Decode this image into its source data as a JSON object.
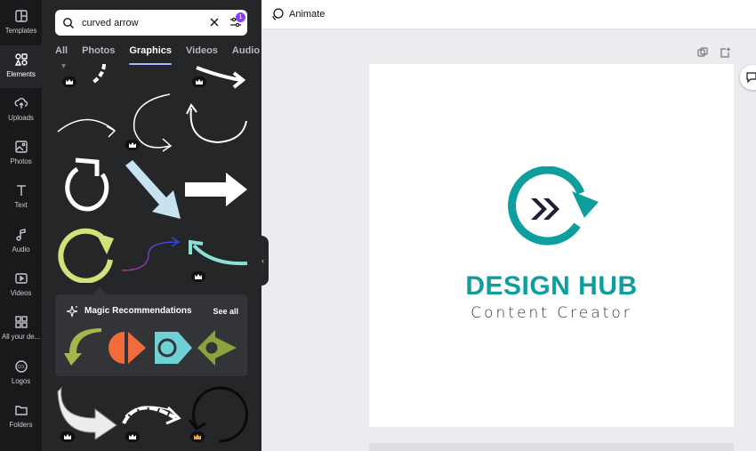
{
  "rail": {
    "items": [
      {
        "label": "Templates",
        "icon": "templates-icon"
      },
      {
        "label": "Elements",
        "icon": "elements-icon"
      },
      {
        "label": "Uploads",
        "icon": "uploads-icon"
      },
      {
        "label": "Photos",
        "icon": "photos-icon"
      },
      {
        "label": "Text",
        "icon": "text-icon"
      },
      {
        "label": "Audio",
        "icon": "audio-icon"
      },
      {
        "label": "Videos",
        "icon": "videos-icon"
      },
      {
        "label": "All your de...",
        "icon": "all-designs-icon"
      },
      {
        "label": "Logos",
        "icon": "logos-icon"
      },
      {
        "label": "Folders",
        "icon": "folders-icon"
      }
    ],
    "active": "Elements"
  },
  "search": {
    "value": "curved arrow",
    "filter_count": "1"
  },
  "tabs": [
    {
      "label": "All"
    },
    {
      "label": "Photos"
    },
    {
      "label": "Graphics"
    },
    {
      "label": "Videos"
    },
    {
      "label": "Audio"
    }
  ],
  "active_tab": "Graphics",
  "magic": {
    "title": "Magic Recommendations",
    "see_all": "See all"
  },
  "topbar": {
    "animate_label": "Animate"
  },
  "design": {
    "brand": "DESIGN HUB",
    "tagline": "Content Creator"
  },
  "colors": {
    "accent": "#8b3dff",
    "brand_teal": "#0f9e9e",
    "brand_navy": "#1d2233",
    "rail_bg": "#18191b",
    "panel_bg": "#252627"
  }
}
